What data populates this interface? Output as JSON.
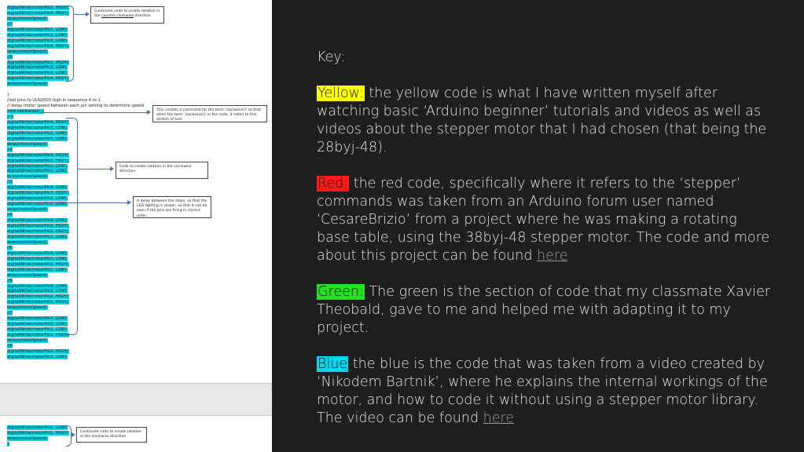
{
  "code_blocks": {
    "block1": [
      "digitalWrite(motorPin3, HIGH);",
      "digitalWrite(motorPin4, HIGH);",
      "delay(motorSpeed);",
      "//7",
      "digitalWrite(motorPin1, LOW);",
      "digitalWrite(motorPin2, LOW);",
      "digitalWrite(motorPin3, LOW);",
      "digitalWrite(motorPin4, HIGH);",
      "delay(motorSpeed);",
      "//8",
      "digitalWrite(motorPin1, HIGH);",
      "digitalWrite(motorPin2, LOW);",
      "digitalWrite(motorPin3, LOW);",
      "digitalWrite(motorPin4, HIGH);",
      "delay(motorSpeed);"
    ],
    "gap1": [
      "",
      "}",
      "",
      ""
    ],
    "comments": [
      "//set pins to ULN2003 high in sequence 4 to 1",
      "// delay motor speed between each pin setting to determine speed"
    ],
    "block2": [
      "void clockwise() {",
      "  // 1",
      "digitalWrite(motorPin4, HIGH);",
      "digitalWrite(motorPin3, LOW);",
      "digitalWrite(motorPin2, LOW);",
      "digitalWrite(motorPin1, LOW);",
      "delay(motorSpeed);",
      "//2",
      "digitalWrite(motorPin4, HIGH);",
      "digitalWrite(motorPin3, HIGH);",
      "digitalWrite(motorPin2, LOW);",
      "digitalWrite(motorPin1, LOW);",
      "delay(motorSpeed);",
      "//3",
      "digitalWrite(motorPin4, LOW);",
      "digitalWrite(motorPin3, HIGH);",
      "digitalWrite(motorPin2, LOW);",
      "digitalWrite(motorPin1, LOW);",
      "delay(motorSpeed);",
      "//4",
      "digitalWrite(motorPin4, LOW);",
      "digitalWrite(motorPin3, HIGH);",
      "digitalWrite(motorPin2, HIGH);",
      "digitalWrite(motorPin1, LOW);",
      "delay(motorSpeed);",
      "//5",
      "digitalWrite(motorPin4, LOW);",
      "digitalWrite(motorPin3, LOW);",
      "digitalWrite(motorPin2, HIGH);",
      "digitalWrite(motorPin1, LOW);",
      "delay(motorSpeed);",
      "//6",
      "digitalWrite(motorPin4, LOW);",
      "digitalWrite(motorPin3, LOW);",
      "digitalWrite(motorPin2, HIGH);",
      "digitalWrite(motorPin1, HIGH);",
      "delay(motorSpeed);",
      "//7",
      "digitalWrite(motorPin4, LOW);",
      "digitalWrite(motorPin3, LOW);",
      "digitalWrite(motorPin2, LOW);",
      "digitalWrite(motorPin1, HIGH);",
      "delay(motorSpeed);",
      "//8",
      "digitalWrite(motorPin4, HIGH);",
      "digitalWrite(motorPin3, LOW);"
    ],
    "block3": [
      "digitalWrite(motorPin2, LOW);",
      "digitalWrite(motorPin1, HIGH);",
      "delay(motorSpeed);",
      "}"
    ]
  },
  "notes": {
    "note1": {
      "line1": "Continued code to create rotation in",
      "prefix": "the ",
      "underlined": "counter-clockwise",
      "suffix": " direction"
    },
    "note2": "This creates a command for the term 'clockwise()' so that when the term 'clockwise()' in the code, it refers to this stretch of text.",
    "note3": "Code to create rotation in the clockwise direction.",
    "note4": "A delay between the steps, so that the LED lighting is slower, so that it can be seen if the pins are firing in correct order.",
    "note5": "Continued code to create rotation in the clockwise direction"
  },
  "key": {
    "heading": "Key:",
    "yellow": {
      "tag": "Yellow:",
      "text": " the yellow code is what I have written myself after watching basic ‘Arduino beginner’ tutorials and videos as well as videos about the stepper motor that I had chosen (that being the 28byj-48)."
    },
    "red": {
      "tag": "Red:",
      "text": " the red code, specifically where it refers to the ‘stepper’ commands was taken from an Arduino forum user named ‘CesareBrizio’ from a project where he was making a rotating base table, using the 38byj-48 stepper motor. The code and more about this project can be found ",
      "link": "here"
    },
    "green": {
      "tag": "Green:",
      "text": " The green is the section of code that my classmate Xavier Theobald, gave to me and helped me with adapting it to my project."
    },
    "blue": {
      "tag": "Blue",
      "text": "  the blue is the code that was taken from a video created by ‘Nikodem Bartnik’, where he explains the internal workings of the motor, and how to code it without using a stepper motor library. The video can be found ",
      "link": "here"
    }
  },
  "colors": {
    "yellow": "#ffff00",
    "red": "#ff1a1a",
    "green": "#22e422",
    "blue": "#00d7f0",
    "code_highlight": "#00d7e6",
    "background": "#1e1e1e"
  }
}
